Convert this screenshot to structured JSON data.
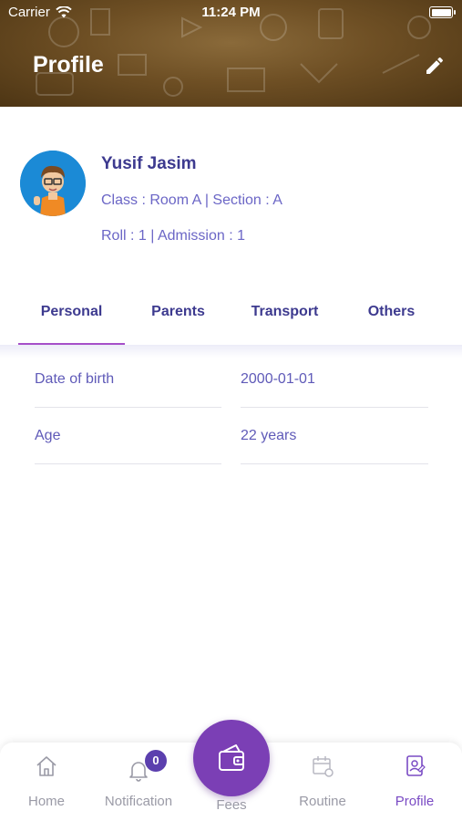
{
  "status_bar": {
    "carrier": "Carrier",
    "time": "11:24 PM"
  },
  "header": {
    "title": "Profile",
    "edit_icon": "pencil-icon",
    "background_color": "#6e4f24"
  },
  "profile": {
    "name": "Yusif Jasim",
    "class_line": "Class : Room A | Section : A",
    "roll_line": "Roll : 1 | Admission : 1"
  },
  "tabs": [
    {
      "label": "Personal",
      "active": true
    },
    {
      "label": "Parents",
      "active": false
    },
    {
      "label": "Transport",
      "active": false
    },
    {
      "label": "Others",
      "active": false
    }
  ],
  "details": [
    {
      "label": "Date of birth",
      "value": "2000-01-01"
    },
    {
      "label": "Age",
      "value": "22 years"
    }
  ],
  "bottom_nav": {
    "items": [
      {
        "label": "Home",
        "icon": "home-icon"
      },
      {
        "label": "Notification",
        "icon": "bell-icon",
        "badge": "0"
      },
      {
        "label": "Fees",
        "icon": "wallet-icon"
      },
      {
        "label": "Routine",
        "icon": "calendar-icon"
      },
      {
        "label": "Profile",
        "icon": "profile-card-icon",
        "active": true
      }
    ]
  },
  "colors": {
    "accent": "#7b3fb5",
    "text_primary": "#3d3a8f",
    "text_secondary": "#6b66c6",
    "tab_indicator": "#a64fc9"
  }
}
